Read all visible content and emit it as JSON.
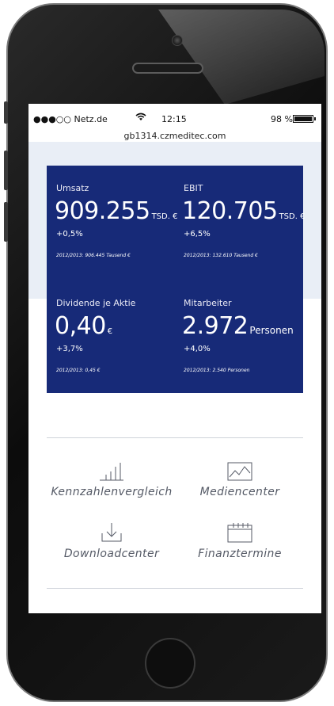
{
  "status_bar": {
    "carrier": "●●●○○ Netz.de",
    "wifi_icon": "wifi-icon",
    "time": "12:15",
    "battery": "98 %"
  },
  "browser": {
    "url": "gb1314.czmeditec.com"
  },
  "kpis": [
    {
      "label": "Umsatz",
      "value": "909.255",
      "unit": "TSD. €",
      "change": "+0,5%",
      "previous": "2012/2013: 906.445 Tausend €"
    },
    {
      "label": "EBIT",
      "value": "120.705",
      "unit": "TSD. €",
      "change": "+6,5%",
      "previous": "2012/2013: 132.610 Tausend €"
    },
    {
      "label": "Dividende je Aktie",
      "value": "0,40",
      "unit": "€",
      "change": "+3,7%",
      "previous": "2012/2013: 0,45 €"
    },
    {
      "label": "Mitarbeiter",
      "value": "2.972",
      "unit": "Personen",
      "change": "+4,0%",
      "previous": "2012/2013: 2.540 Personen"
    }
  ],
  "nav": [
    {
      "label": "Kennzahlenvergleich",
      "icon": "bar-chart-icon"
    },
    {
      "label": "Mediencenter",
      "icon": "image-icon"
    },
    {
      "label": "Downloadcenter",
      "icon": "download-icon"
    },
    {
      "label": "Finanztermine",
      "icon": "calendar-icon"
    }
  ],
  "colors": {
    "kpi_panel": "#172a78",
    "header_band": "#e9eef6",
    "nav_text": "#555a66"
  }
}
